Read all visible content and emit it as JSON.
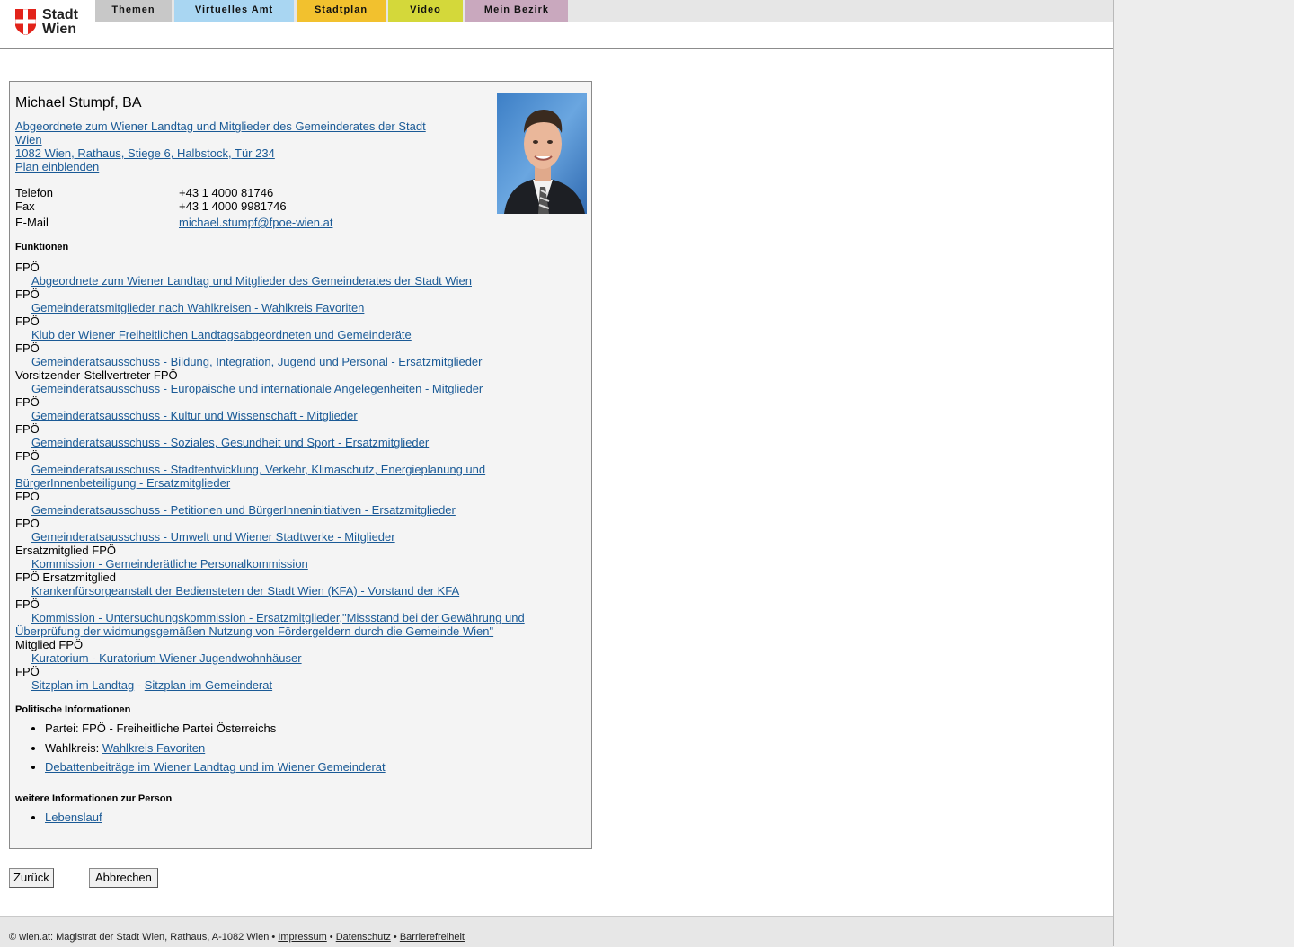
{
  "header": {
    "logo": {
      "line1": "Stadt",
      "line2": "Wien"
    },
    "nav": [
      {
        "label": "Themen",
        "color": "#c8c8c8"
      },
      {
        "label": "Virtuelles Amt",
        "color": "#a9d6f2"
      },
      {
        "label": "Stadtplan",
        "color": "#f2c12e"
      },
      {
        "label": "Video",
        "color": "#d4d83a"
      },
      {
        "label": "Mein Bezirk",
        "color": "#c9a8be"
      }
    ]
  },
  "person": {
    "name": "Michael Stumpf, BA",
    "role_link_line1": "Abgeordnete zum Wiener Landtag und Mitglieder des Gemeinderates der Stadt",
    "role_link_line2": "Wien",
    "address": "1082 Wien, Rathaus, Stiege 6, Halbstock, Tür 234",
    "map_link": "Plan einblenden",
    "contact": {
      "phone_label": "Telefon",
      "phone": "+43 1 4000 81746",
      "fax_label": "Fax",
      "fax": "+43 1 4000 9981746",
      "email_label": "E-Mail",
      "email": "michael.stumpf@fpoe-wien.at"
    }
  },
  "functions": {
    "heading": "Funktionen",
    "items": [
      {
        "role": "FPÖ",
        "link": "Abgeordnete zum Wiener Landtag und Mitglieder des Gemeinderates der Stadt Wien"
      },
      {
        "role": "FPÖ",
        "link": "Gemeinderatsmitglieder nach Wahlkreisen - Wahlkreis Favoriten"
      },
      {
        "role": "FPÖ",
        "link": "Klub der Wiener Freiheitlichen Landtagsabgeordneten und Gemeinderäte"
      },
      {
        "role": "FPÖ",
        "link": "Gemeinderatsausschuss - Bildung, Integration, Jugend und Personal - Ersatzmitglieder"
      },
      {
        "role": "Vorsitzender-Stellvertreter FPÖ",
        "link": "Gemeinderatsausschuss - Europäische und internationale Angelegenheiten - Mitglieder"
      },
      {
        "role": "FPÖ",
        "link": "Gemeinderatsausschuss - Kultur und Wissenschaft - Mitglieder"
      },
      {
        "role": "FPÖ",
        "link": "Gemeinderatsausschuss - Soziales, Gesundheit und Sport - Ersatzmitglieder"
      },
      {
        "role": "FPÖ",
        "link": "Gemeinderatsausschuss - Stadtentwicklung, Verkehr, Klimaschutz, Energieplanung und",
        "link2": "BürgerInnenbeteiligung - Ersatzmitglieder"
      },
      {
        "role": "FPÖ",
        "link": "Gemeinderatsausschuss - Petitionen und BürgerInneninitiativen - Ersatzmitglieder"
      },
      {
        "role": "FPÖ",
        "link": "Gemeinderatsausschuss - Umwelt und Wiener Stadtwerke - Mitglieder"
      },
      {
        "role": "Ersatzmitglied FPÖ",
        "link": "Kommission - Gemeinderätliche Personalkommission"
      },
      {
        "role": "FPÖ Ersatzmitglied",
        "link": "Krankenfürsorgeanstalt der Bediensteten der Stadt Wien (KFA) - Vorstand der KFA"
      },
      {
        "role": "FPÖ",
        "link": "Kommission - Untersuchungskommission - Ersatzmitglieder,\"Missstand bei der Gewährung und",
        "link2": "Überprüfung der widmungsgemäßen Nutzung von Fördergeldern durch die Gemeinde Wien\""
      },
      {
        "role": "Mitglied FPÖ",
        "link": "Kuratorium - Kuratorium Wiener Jugendwohnhäuser"
      },
      {
        "role": "FPÖ",
        "link": "Sitzplan im Landtag",
        "sep": " - ",
        "link_b": "Sitzplan im Gemeinderat"
      }
    ]
  },
  "politics": {
    "heading": "Politische Informationen",
    "party": "Partei: FPÖ - Freiheitliche Partei Österreichs",
    "district_prefix": "Wahlkreis: ",
    "district_link": "Wahlkreis Favoriten",
    "debates_link": "Debattenbeiträge im Wiener Landtag und im Wiener Gemeinderat"
  },
  "more": {
    "heading": "weitere Informationen zur Person",
    "cv_link": "Lebenslauf"
  },
  "buttons": {
    "back": "Zurück",
    "cancel": "Abbrechen"
  },
  "footer": {
    "copyright": "© wien.at: Magistrat der Stadt Wien, Rathaus, A-1082 Wien",
    "sep": " • ",
    "links": [
      "Impressum",
      "Datenschutz",
      "Barrierefreiheit"
    ]
  }
}
